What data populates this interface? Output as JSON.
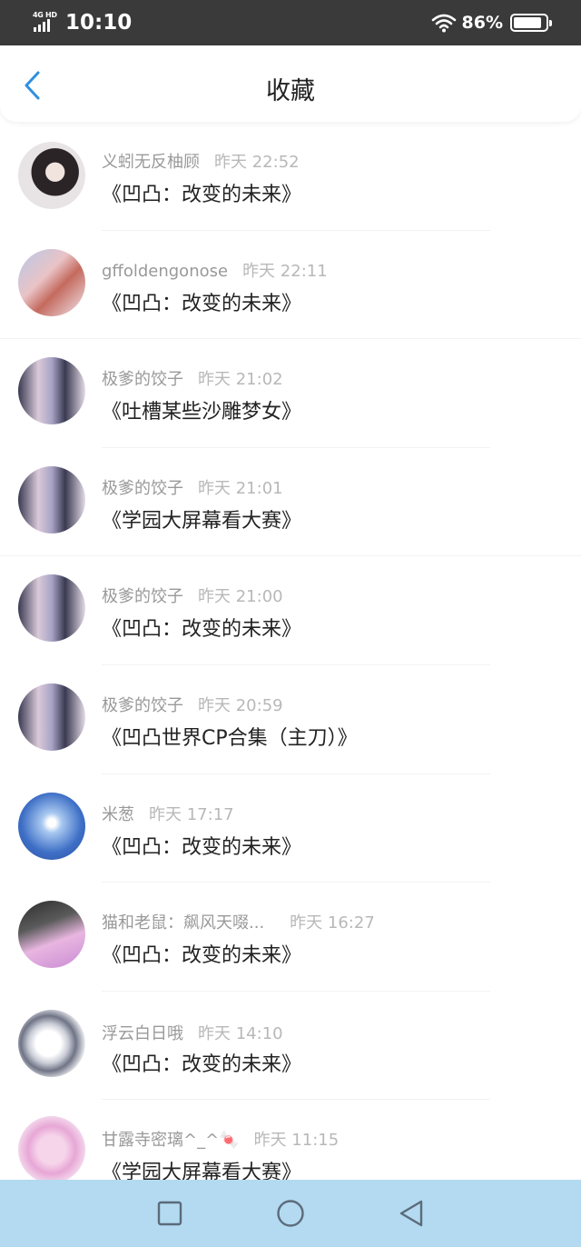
{
  "status_bar": {
    "network": "4G HD",
    "time": "10:10",
    "battery": "86%"
  },
  "header": {
    "title": "收藏"
  },
  "colors": {
    "accent": "#2f8fe0",
    "status_bar_bg": "#3a3a3a",
    "nav_bar_bg": "#b3daf1"
  },
  "items": [
    {
      "user": "义蚓无反柚顾",
      "time": "昨天 22:52",
      "title": "《凹凸：改变的未来》"
    },
    {
      "user": "gffoldengonose",
      "time": "昨天 22:11",
      "title": "《凹凸：改变的未来》"
    },
    {
      "user": "极爹的饺子",
      "time": "昨天 21:02",
      "title": "《吐槽某些沙雕梦女》"
    },
    {
      "user": "极爹的饺子",
      "time": "昨天 21:01",
      "title": "《学园大屏幕看大赛》"
    },
    {
      "user": "极爹的饺子",
      "time": "昨天 21:00",
      "title": "《凹凸：改变的未来》"
    },
    {
      "user": "极爹的饺子",
      "time": "昨天 20:59",
      "title": "《凹凸世界CP合集（主刀）》"
    },
    {
      "user": "米葱",
      "time": "昨天 17:17",
      "title": "《凹凸：改变的未来》"
    },
    {
      "user": "猫和老鼠：飙风天啜...",
      "time": "昨天 16:27",
      "title": "《凹凸：改变的未来》"
    },
    {
      "user": "浮云白日哦",
      "time": "昨天 14:10",
      "title": "《凹凸：改变的未来》"
    },
    {
      "user": "甘露寺密璃^_^🍬",
      "time": "昨天 11:15",
      "title": "《学园大屏幕看大赛》"
    }
  ],
  "icons": {
    "back": "chevron-left-icon",
    "wifi": "wifi-icon",
    "battery": "battery-icon",
    "nav_recent": "square-icon",
    "nav_home": "circle-icon",
    "nav_back": "triangle-back-icon"
  }
}
